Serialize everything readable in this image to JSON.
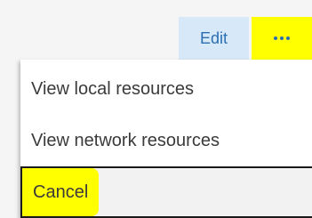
{
  "toolbar": {
    "edit_label": "Edit",
    "more_icon": "more-horizontal-icon",
    "more_highlight_color": "#ffff00",
    "accent_color": "#2b6fb3"
  },
  "menu": {
    "items": [
      {
        "label": "View local resources"
      },
      {
        "label": "View network resources"
      },
      {
        "label": "Cancel"
      }
    ],
    "cancel_highlight_color": "#ffff00"
  }
}
